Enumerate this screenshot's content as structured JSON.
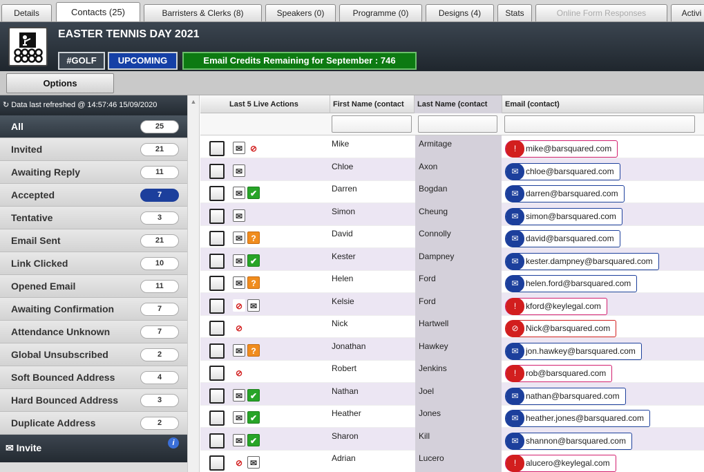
{
  "tabs": [
    "Details",
    "Contacts (25)",
    "Barristers & Clerks (8)",
    "Speakers (0)",
    "Programme (0)",
    "Designs (4)",
    "Stats",
    "Online Form Responses",
    "Activi"
  ],
  "header": {
    "event_title": "EASTER TENNIS DAY 2021",
    "tag": "#GOLF",
    "status": "UPCOMING",
    "credits": "Email Credits Remaining for September : 746"
  },
  "options_label": "Options",
  "refresh_text": "Data last refreshed @ 14:57:46 15/09/2020",
  "filters": [
    {
      "label": "All",
      "count": "25"
    },
    {
      "label": "Invited",
      "count": "21"
    },
    {
      "label": "Awaiting Reply",
      "count": "11"
    },
    {
      "label": "Accepted",
      "count": "7"
    },
    {
      "label": "Tentative",
      "count": "3"
    },
    {
      "label": "Email Sent",
      "count": "21"
    },
    {
      "label": "Link Clicked",
      "count": "10"
    },
    {
      "label": "Opened Email",
      "count": "11"
    },
    {
      "label": "Awaiting Confirmation",
      "count": "7"
    },
    {
      "label": "Attendance Unknown",
      "count": "7"
    },
    {
      "label": "Global Unsubscribed",
      "count": "2"
    },
    {
      "label": "Soft Bounced Address",
      "count": "4"
    },
    {
      "label": "Hard Bounced Address",
      "count": "3"
    },
    {
      "label": "Duplicate Address",
      "count": "2"
    }
  ],
  "invite_label": "Invite",
  "columns": {
    "live_actions": "Last 5 Live Actions",
    "first_name": "First Name (contact",
    "last_name": "Last Name (contact",
    "email": "Email (contact)"
  },
  "icons": {
    "envelope": "envelope-plus-icon",
    "accepted": "green-check-icon",
    "tentative": "orange-question-icon",
    "declined": "red-no-entry-icon"
  },
  "colors": {
    "header": "#2c343c",
    "status_blue": "#1540a6",
    "credits_green": "#0d7a12",
    "row_alt": "#ece6f3",
    "email_blue": "#1c3f9c",
    "warning_red": "#d21e1e"
  },
  "contacts": [
    {
      "first": "Mike",
      "last": "Armitage",
      "email": "mike@barsquared.com",
      "email_state": "warn",
      "actions": [
        "envelope",
        "declined"
      ]
    },
    {
      "first": "Chloe",
      "last": "Axon",
      "email": "chloe@barsquared.com",
      "email_state": "ok",
      "actions": [
        "envelope"
      ]
    },
    {
      "first": "Darren",
      "last": "Bogdan",
      "email": "darren@barsquared.com",
      "email_state": "ok",
      "actions": [
        "envelope",
        "accepted"
      ]
    },
    {
      "first": "Simon",
      "last": "Cheung",
      "email": "simon@barsquared.com",
      "email_state": "ok",
      "actions": [
        "envelope"
      ]
    },
    {
      "first": "David",
      "last": "Connolly",
      "email": "david@barsquared.com",
      "email_state": "ok",
      "actions": [
        "envelope",
        "tentative"
      ]
    },
    {
      "first": "Kester",
      "last": "Dampney",
      "email": "kester.dampney@barsquared.com",
      "email_state": "ok",
      "actions": [
        "envelope",
        "accepted"
      ]
    },
    {
      "first": "Helen",
      "last": "Ford",
      "email": "helen.ford@barsquared.com",
      "email_state": "ok",
      "actions": [
        "envelope",
        "tentative"
      ]
    },
    {
      "first": "Kelsie",
      "last": "Ford",
      "email": "kford@keylegal.com",
      "email_state": "warn",
      "actions": [
        "declined",
        "envelope"
      ]
    },
    {
      "first": "Nick",
      "last": "Hartwell",
      "email": "Nick@barsquared.com",
      "email_state": "bad",
      "actions": [
        "declined"
      ]
    },
    {
      "first": "Jonathan",
      "last": "Hawkey",
      "email": "jon.hawkey@barsquared.com",
      "email_state": "ok",
      "actions": [
        "envelope",
        "tentative"
      ]
    },
    {
      "first": "Robert",
      "last": "Jenkins",
      "email": "rob@barsquared.com",
      "email_state": "warn",
      "actions": [
        "declined"
      ]
    },
    {
      "first": "Nathan",
      "last": "Joel",
      "email": "nathan@barsquared.com",
      "email_state": "ok",
      "actions": [
        "envelope",
        "accepted"
      ]
    },
    {
      "first": "Heather",
      "last": "Jones",
      "email": "heather.jones@barsquared.com",
      "email_state": "ok",
      "actions": [
        "envelope",
        "accepted"
      ]
    },
    {
      "first": "Sharon",
      "last": "Kill",
      "email": "shannon@barsquared.com",
      "email_state": "ok",
      "actions": [
        "envelope",
        "accepted"
      ]
    },
    {
      "first": "Adrian",
      "last": "Lucero",
      "email": "alucero@keylegal.com",
      "email_state": "warn",
      "actions": [
        "declined",
        "envelope"
      ]
    }
  ]
}
